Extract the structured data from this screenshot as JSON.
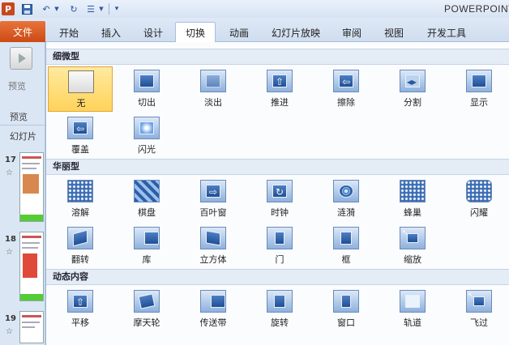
{
  "app": {
    "title": "POWERPOINT"
  },
  "file_tab": {
    "label": "文件"
  },
  "tabs": [
    "开始",
    "插入",
    "设计",
    "切换",
    "动画",
    "幻灯片放映",
    "审阅",
    "视图",
    "开发工具"
  ],
  "active_tab": "切换",
  "left_panel": {
    "preview_label": "预览",
    "group_label": "预览",
    "slides_label": "幻灯片",
    "slides": [
      {
        "number": "17",
        "star": "☆"
      },
      {
        "number": "18",
        "star": "☆"
      },
      {
        "number": "19",
        "star": "☆"
      }
    ]
  },
  "gallery": {
    "sections": [
      {
        "title": "细微型",
        "items": [
          "无",
          "切出",
          "淡出",
          "推进",
          "擦除",
          "分割",
          "显示",
          "覆盖",
          "闪光"
        ]
      },
      {
        "title": "华丽型",
        "items": [
          "溶解",
          "棋盘",
          "百叶窗",
          "时钟",
          "涟漪",
          "蜂巢",
          "闪耀",
          "翻转",
          "库",
          "立方体",
          "门",
          "框",
          "缩放"
        ]
      },
      {
        "title": "动态内容",
        "items": [
          "平移",
          "摩天轮",
          "传送带",
          "旋转",
          "窗口",
          "轨道",
          "飞过"
        ]
      }
    ],
    "selected_item": "无"
  },
  "icons": {
    "app": "powerpoint-icon",
    "save": "save-icon",
    "undo": "undo-icon",
    "redo": "redo-icon",
    "list": "bullet-list-icon",
    "more": "customize-quick-access-icon"
  },
  "colors": {
    "file_tab": "#cc4a14",
    "selection": "#ffd35a",
    "ribbon": "#dfe9f6"
  }
}
